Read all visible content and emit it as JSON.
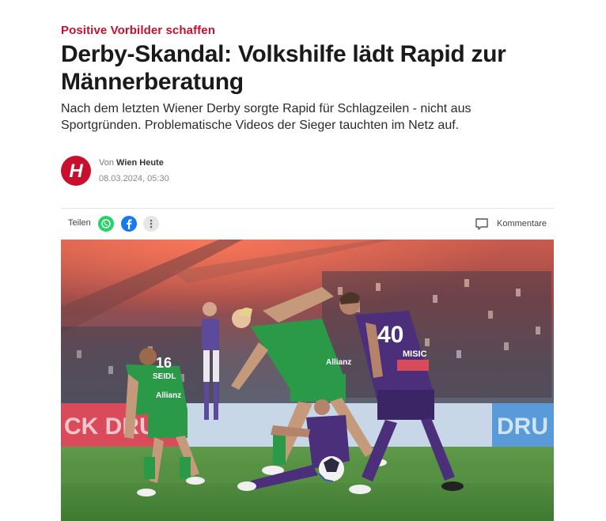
{
  "article": {
    "kicker": "Positive Vorbilder schaffen",
    "headline": "Derby-Skandal: Volkshilfe lädt Rapid zur Männerberatung",
    "lead": "Nach dem letzten Wiener Derby sorgte Rapid für Schlagzeilen - nicht aus Sportgründen. Problematische Videos der Sieger tauchten im Netz auf."
  },
  "author": {
    "logo_letter": "H",
    "by_prefix": "Von",
    "name": "Wien Heute",
    "date": "08.03.2024, 05:30"
  },
  "share": {
    "label": "Teilen",
    "buttons": [
      "whatsapp-icon",
      "facebook-icon",
      "more-icon"
    ],
    "comments_label": "Kommentare"
  },
  "colors": {
    "accent": "#c8102e",
    "rapid_green": "#1f8a3b",
    "austria_purple": "#4b2f7a"
  },
  "image": {
    "board_left_text": "CK DRU",
    "board_right_text": "DRU",
    "jersey_left_number": "16",
    "jersey_left_name": "SEIDL",
    "jersey_right_number": "40",
    "jersey_right_name": "MISIC",
    "jersey_sponsor": "Allianz"
  }
}
